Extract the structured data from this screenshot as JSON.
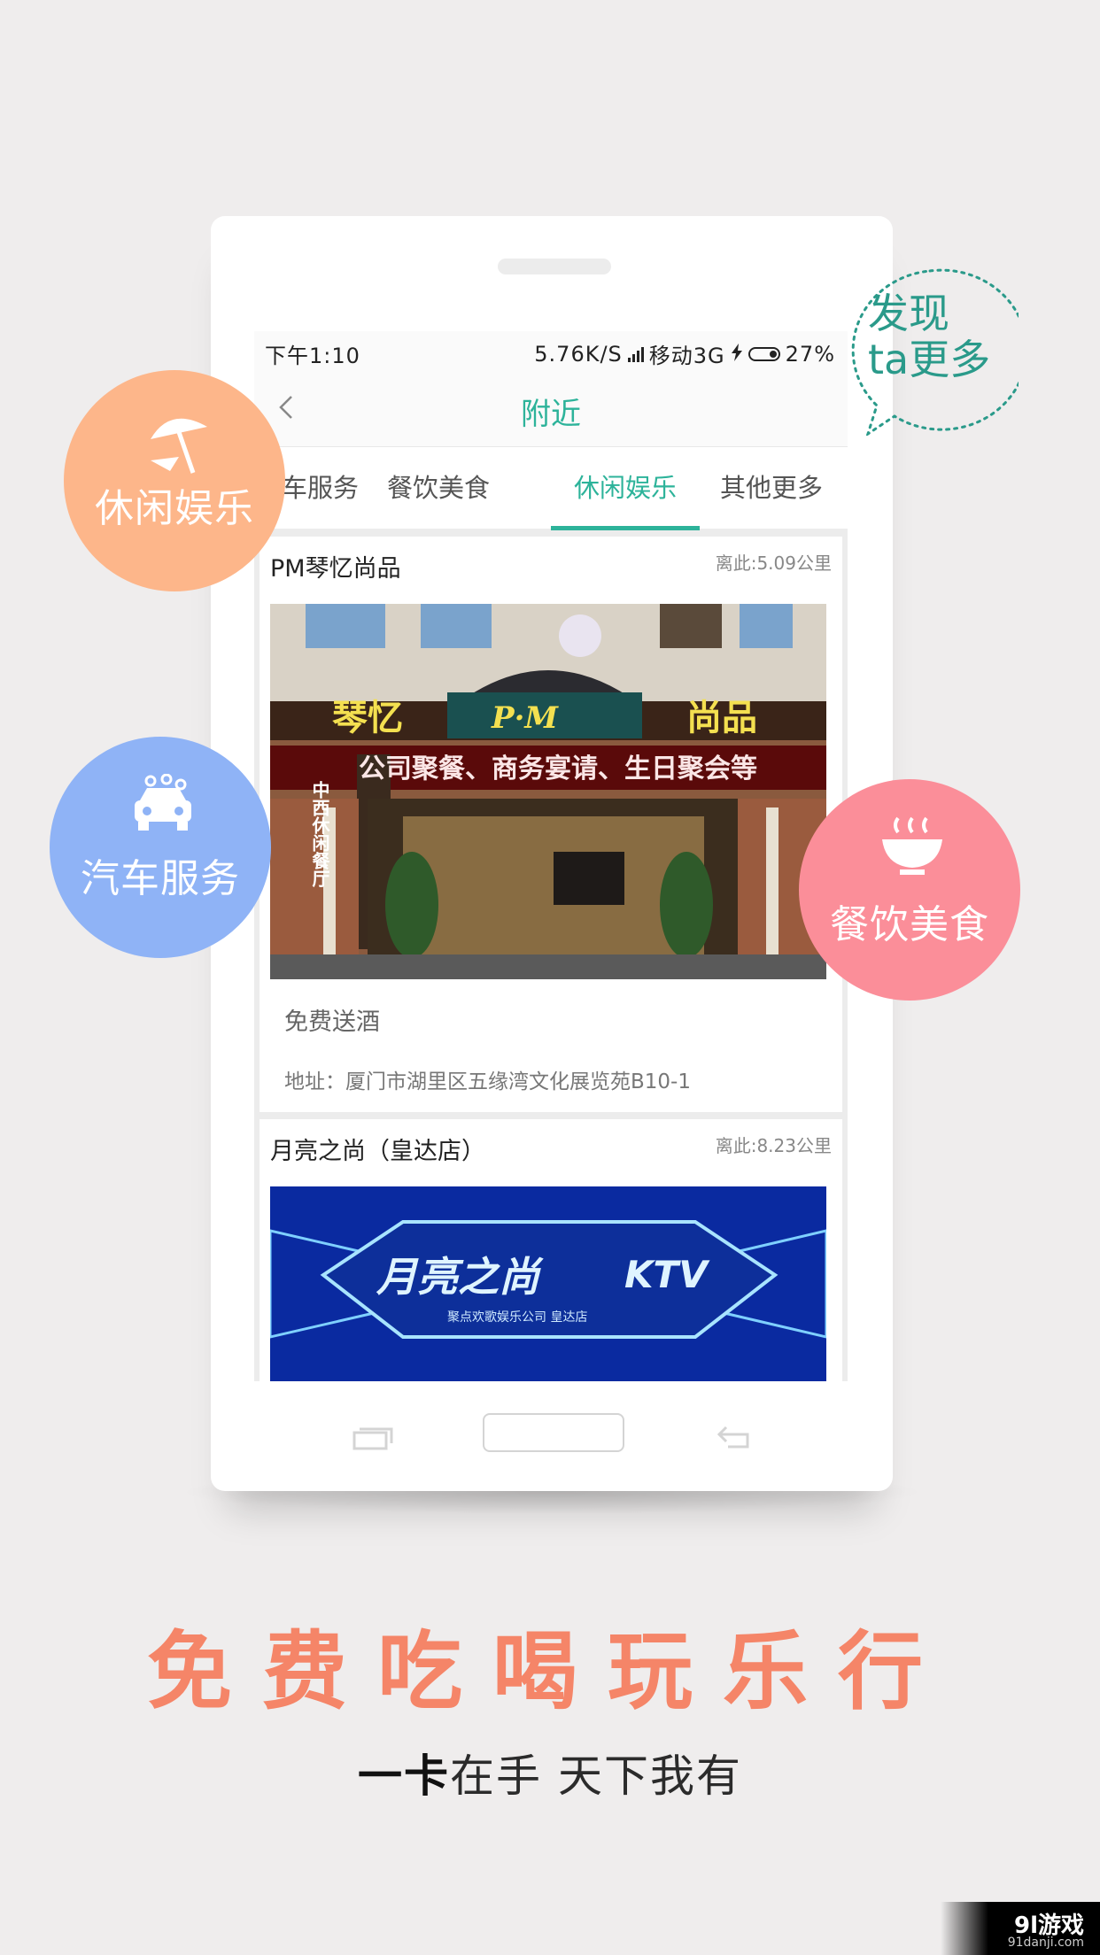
{
  "statusbar": {
    "time": "下午1:10",
    "speed": "5.76K/S",
    "carrier": "移动3G",
    "battery": "27%"
  },
  "nav": {
    "title": "附近"
  },
  "tabs": [
    {
      "label": "汽车服务"
    },
    {
      "label": "餐饮美食"
    },
    {
      "label": "休闲娱乐",
      "active": true
    },
    {
      "label": "其他更多"
    }
  ],
  "cards": [
    {
      "title": "PM琴忆尚品",
      "distance": "离此:5.09公里",
      "promo": "免费送酒",
      "address": "地址：厦门市湖里区五缘湾文化展览苑B10-1",
      "sign_main": "琴忆",
      "sign_pm": "P·M",
      "sign_side": "尚品",
      "sign_led": "公司聚餐、商务宴请、生日聚会等",
      "sign_vertical": "中西休闲餐厅"
    },
    {
      "title": "月亮之尚（皇达店）",
      "distance": "离此:8.23公里",
      "sign_main": "月亮之尚",
      "sign_ktv": "KTV",
      "sign_sub": "聚点欢歌娱乐公司  皇达店"
    }
  ],
  "bubbles": {
    "leisure": "休闲娱乐",
    "car": "汽车服务",
    "food": "餐饮美食",
    "speech_line1": "发现",
    "speech_line2": "ta更多"
  },
  "headline": "免费吃喝玩乐行",
  "subline_bold": "一卡",
  "subline_rest": "在手 天下我有",
  "watermark": {
    "main": "9l游戏",
    "sub": "91danji.com"
  },
  "colors": {
    "accent": "#2db39a",
    "leisure": "#fdb68a",
    "car": "#8fb3f6",
    "food": "#fb8e99",
    "headline": "#f58568"
  }
}
